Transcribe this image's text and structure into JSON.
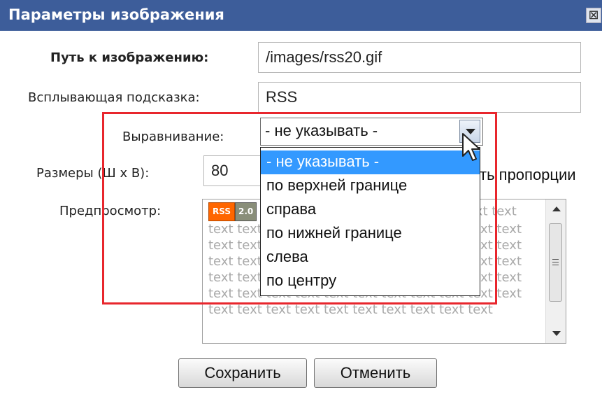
{
  "dialog": {
    "title": "Параметры изображения",
    "close_symbol": "⊠"
  },
  "form": {
    "image_path": {
      "label": "Путь к изображению:",
      "value": "/images/rss20.gif"
    },
    "tooltip": {
      "label": "Всплывающая подсказка:",
      "value": "RSS"
    },
    "alignment": {
      "label": "Выравнивание:",
      "selected": "- не указывать -",
      "options": [
        "- не указывать -",
        "по верхней границе",
        "справа",
        "по нижней границе",
        "слева",
        "по центру"
      ]
    },
    "size": {
      "label": "Размеры (Ш х В):",
      "width_value": "80",
      "proportions_partial": "ть пропорции"
    },
    "preview": {
      "label": "Предпросмотр:",
      "badge_left": "RSS",
      "badge_right": "2.0",
      "filler_text": "text text text text text text text text text text text text text text text text text text text text text text text text text text text text text text text text text text text text text text text text text text text text text text text text text text text text text text text text text text text text text text text text text text text text text text text text text text"
    }
  },
  "buttons": {
    "save": "Сохранить",
    "cancel": "Отменить"
  },
  "colors": {
    "titlebar": "#3d5d9a",
    "highlight": "#3399ff",
    "annotation": "#e8262d"
  },
  "icons": {
    "close": "close-icon",
    "dropdown": "chevron-down-icon",
    "cursor": "mouse-pointer-icon"
  }
}
